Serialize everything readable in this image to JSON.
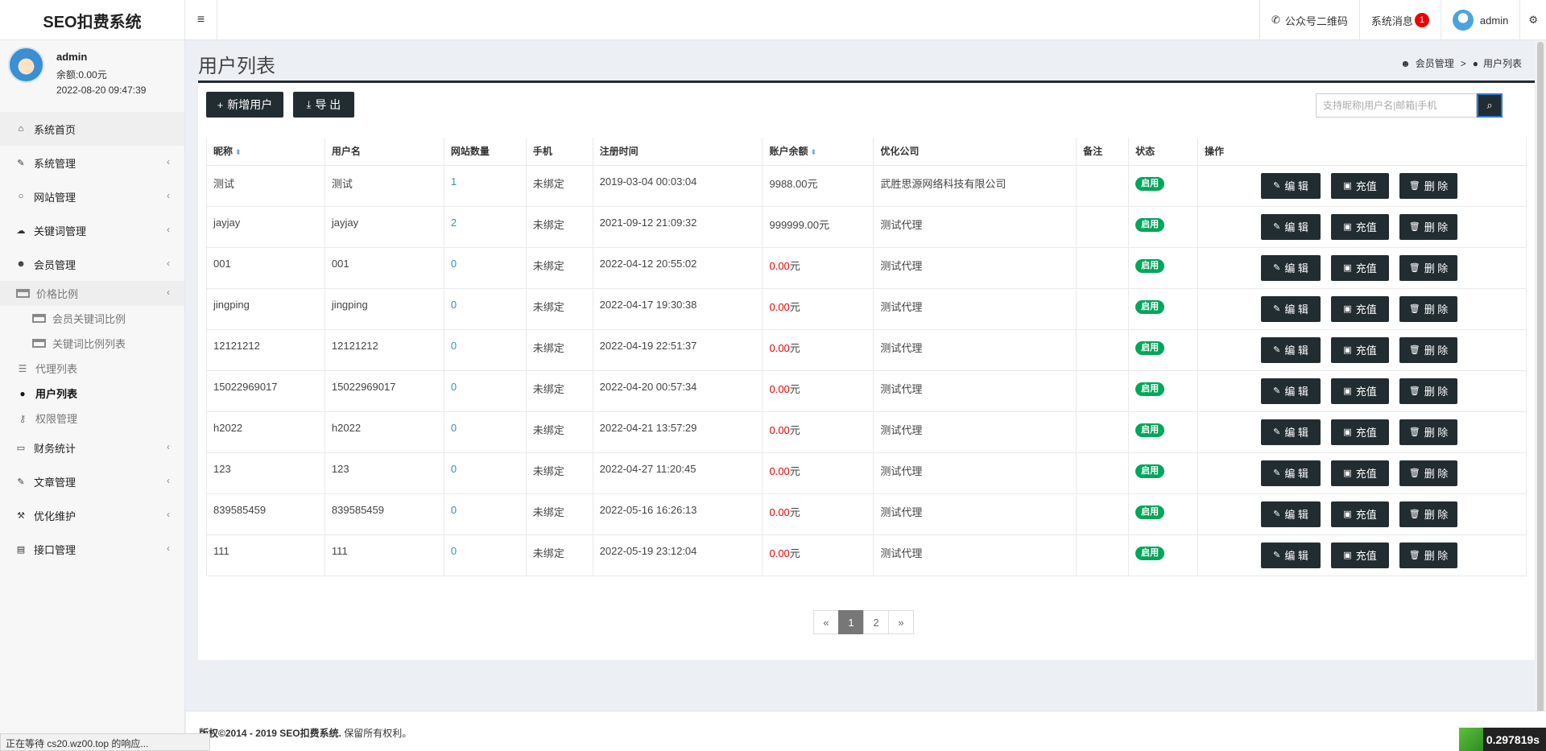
{
  "app": {
    "brand": "SEO扣费系统",
    "menu_toggle": "≡",
    "wechat_label": "公众号二维码",
    "messages_label": "系统消息",
    "messages_count": "1",
    "top_user": "admin"
  },
  "user": {
    "name": "admin",
    "balance": "余额:0.00元",
    "time": "2022-08-20 09:47:39"
  },
  "nav": {
    "home": "系统首页",
    "system": "系统管理",
    "site": "网站管理",
    "keyword": "关键词管理",
    "member": "会员管理",
    "price_ratio": "价格比例",
    "member_keyword_ratio": "会员关键词比例",
    "keyword_ratio_list": "关键词比例列表",
    "agent_list": "代理列表",
    "user_list": "用户列表",
    "permission": "权限管理",
    "finance": "财务统计",
    "article": "文章管理",
    "optimize": "优化维护",
    "api": "接口管理"
  },
  "page": {
    "title": "用户列表",
    "breadcrumb_parent": "会员管理",
    "breadcrumb_sep": ">",
    "breadcrumb_current": "用户列表"
  },
  "toolbar": {
    "add_label": "新增用户",
    "export_label": "导 出",
    "search_placeholder": "支持昵称|用户名|邮箱|手机"
  },
  "table": {
    "headers": [
      "昵称",
      "用户名",
      "网站数量",
      "手机",
      "注册时间",
      "账户余额",
      "优化公司",
      "备注",
      "状态",
      "操作"
    ],
    "edit_label": "编 辑",
    "charge_label": "充值",
    "delete_label": "删 除",
    "rows": [
      {
        "nick": "测试",
        "username": "测试",
        "sites": "1",
        "phone": "未绑定",
        "reg": "2019-03-04 00:03:04",
        "amount": "9988.00",
        "unit": "元",
        "company": "武胜思源网络科技有限公司",
        "note": "",
        "status": "启用"
      },
      {
        "nick": "jayjay",
        "username": "jayjay",
        "sites": "2",
        "phone": "未绑定",
        "reg": "2021-09-12 21:09:32",
        "amount": "999999.00",
        "unit": "元",
        "company": "测试代理",
        "note": "",
        "status": "启用"
      },
      {
        "nick": "001",
        "username": "001",
        "sites": "0",
        "phone": "未绑定",
        "reg": "2022-04-12 20:55:02",
        "amount": "0.00",
        "unit": "元",
        "company": "测试代理",
        "note": "",
        "status": "启用"
      },
      {
        "nick": "jingping",
        "username": "jingping",
        "sites": "0",
        "phone": "未绑定",
        "reg": "2022-04-17 19:30:38",
        "amount": "0.00",
        "unit": "元",
        "company": "测试代理",
        "note": "",
        "status": "启用"
      },
      {
        "nick": "12121212",
        "username": "12121212",
        "sites": "0",
        "phone": "未绑定",
        "reg": "2022-04-19 22:51:37",
        "amount": "0.00",
        "unit": "元",
        "company": "测试代理",
        "note": "",
        "status": "启用"
      },
      {
        "nick": "15022969017",
        "username": "15022969017",
        "sites": "0",
        "phone": "未绑定",
        "reg": "2022-04-20 00:57:34",
        "amount": "0.00",
        "unit": "元",
        "company": "测试代理",
        "note": "",
        "status": "启用"
      },
      {
        "nick": "h2022",
        "username": "h2022",
        "sites": "0",
        "phone": "未绑定",
        "reg": "2022-04-21 13:57:29",
        "amount": "0.00",
        "unit": "元",
        "company": "测试代理",
        "note": "",
        "status": "启用"
      },
      {
        "nick": "123",
        "username": "123",
        "sites": "0",
        "phone": "未绑定",
        "reg": "2022-04-27 11:20:45",
        "amount": "0.00",
        "unit": "元",
        "company": "测试代理",
        "note": "",
        "status": "启用"
      },
      {
        "nick": "839585459",
        "username": "839585459",
        "sites": "0",
        "phone": "未绑定",
        "reg": "2022-05-16 16:26:13",
        "amount": "0.00",
        "unit": "元",
        "company": "测试代理",
        "note": "",
        "status": "启用"
      },
      {
        "nick": "111",
        "username": "111",
        "sites": "0",
        "phone": "未绑定",
        "reg": "2022-05-19 23:12:04",
        "amount": "0.00",
        "unit": "元",
        "company": "测试代理",
        "note": "",
        "status": "启用"
      }
    ]
  },
  "pagination": {
    "prev": "«",
    "pages": [
      "1",
      "2"
    ],
    "next": "»"
  },
  "footer": {
    "copyright": "版权©2014 - 2019 SEO扣费系统.",
    "rights": " 保留所有权利。"
  },
  "browser": {
    "status": "正在等待 cs20.wz00.top 的响应...",
    "timer": "0.297819s"
  },
  "colors": {
    "dark": "#222d32",
    "success": "#00a65a",
    "danger": "#ee0000",
    "link": "#3c8dbc"
  }
}
